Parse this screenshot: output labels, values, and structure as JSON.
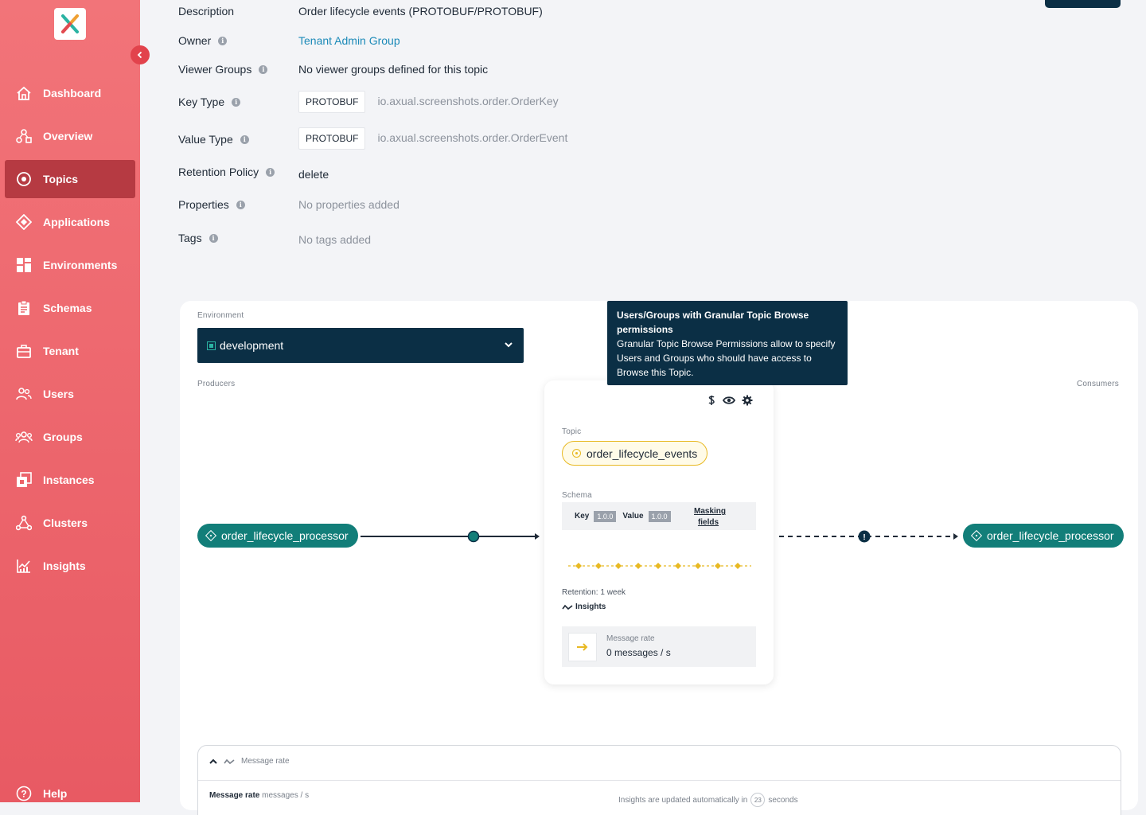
{
  "sidebar": {
    "items": [
      {
        "label": "Dashboard",
        "icon": "home-icon"
      },
      {
        "label": "Overview",
        "icon": "overview-icon"
      },
      {
        "label": "Topics",
        "icon": "topic-icon"
      },
      {
        "label": "Applications",
        "icon": "application-icon"
      },
      {
        "label": "Environments",
        "icon": "grid-icon"
      },
      {
        "label": "Schemas",
        "icon": "clipboard-icon"
      },
      {
        "label": "Tenant",
        "icon": "briefcase-icon"
      },
      {
        "label": "Users",
        "icon": "users-icon"
      },
      {
        "label": "Groups",
        "icon": "groups-icon"
      },
      {
        "label": "Instances",
        "icon": "instances-icon"
      },
      {
        "label": "Clusters",
        "icon": "clusters-icon"
      },
      {
        "label": "Insights",
        "icon": "insights-icon"
      }
    ],
    "active": "Topics",
    "help_label": "Help"
  },
  "details": {
    "description_label": "Description",
    "description_value": "Order lifecycle events (PROTOBUF/PROTOBUF)",
    "owner_label": "Owner",
    "owner_value": "Tenant Admin Group",
    "viewer_groups_label": "Viewer Groups",
    "viewer_groups_value": "No viewer groups defined for this topic",
    "key_type_label": "Key Type",
    "key_type_badge": "PROTOBUF",
    "key_type_value": "io.axual.screenshots.order.OrderKey",
    "value_type_label": "Value Type",
    "value_type_badge": "PROTOBUF",
    "value_type_value": "io.axual.screenshots.order.OrderEvent",
    "retention_label": "Retention Policy",
    "retention_value": "delete",
    "properties_label": "Properties",
    "properties_value": "No properties added",
    "tags_label": "Tags",
    "tags_value": "No tags added"
  },
  "graph": {
    "environment_label": "Environment",
    "environment_value": "development",
    "producers_label": "Producers",
    "consumers_label": "Consumers",
    "producer_app": "order_lifecycle_processor",
    "consumer_app": "order_lifecycle_processor",
    "tooltip_title": "Users/Groups with Granular Topic Browse permissions",
    "tooltip_body": "Granular Topic Browse Permissions allow to specify Users and Groups who should have access to Browse this Topic.",
    "topic_label": "Topic",
    "topic_name": "order_lifecycle_events",
    "schema_label": "Schema",
    "key_label": "Key",
    "key_version": "1.0.0",
    "value_label": "Value",
    "value_version": "1.0.0",
    "masking_label": "Masking fields",
    "retention_text": "Retention: 1 week",
    "insights_label": "Insights",
    "rate_label": "Message rate",
    "rate_value": "0 messages / s"
  },
  "insights_panel": {
    "header": "Message rate",
    "title": "Message rate",
    "unit": "messages / s",
    "update_prefix": "Insights are updated automatically in",
    "countdown": "23",
    "update_suffix": "seconds"
  },
  "colors": {
    "sidebar": "#ec6369",
    "active": "#b63a42",
    "navy": "#0b2f45",
    "teal": "#127e79",
    "topic_yellow": "#e8b923"
  }
}
